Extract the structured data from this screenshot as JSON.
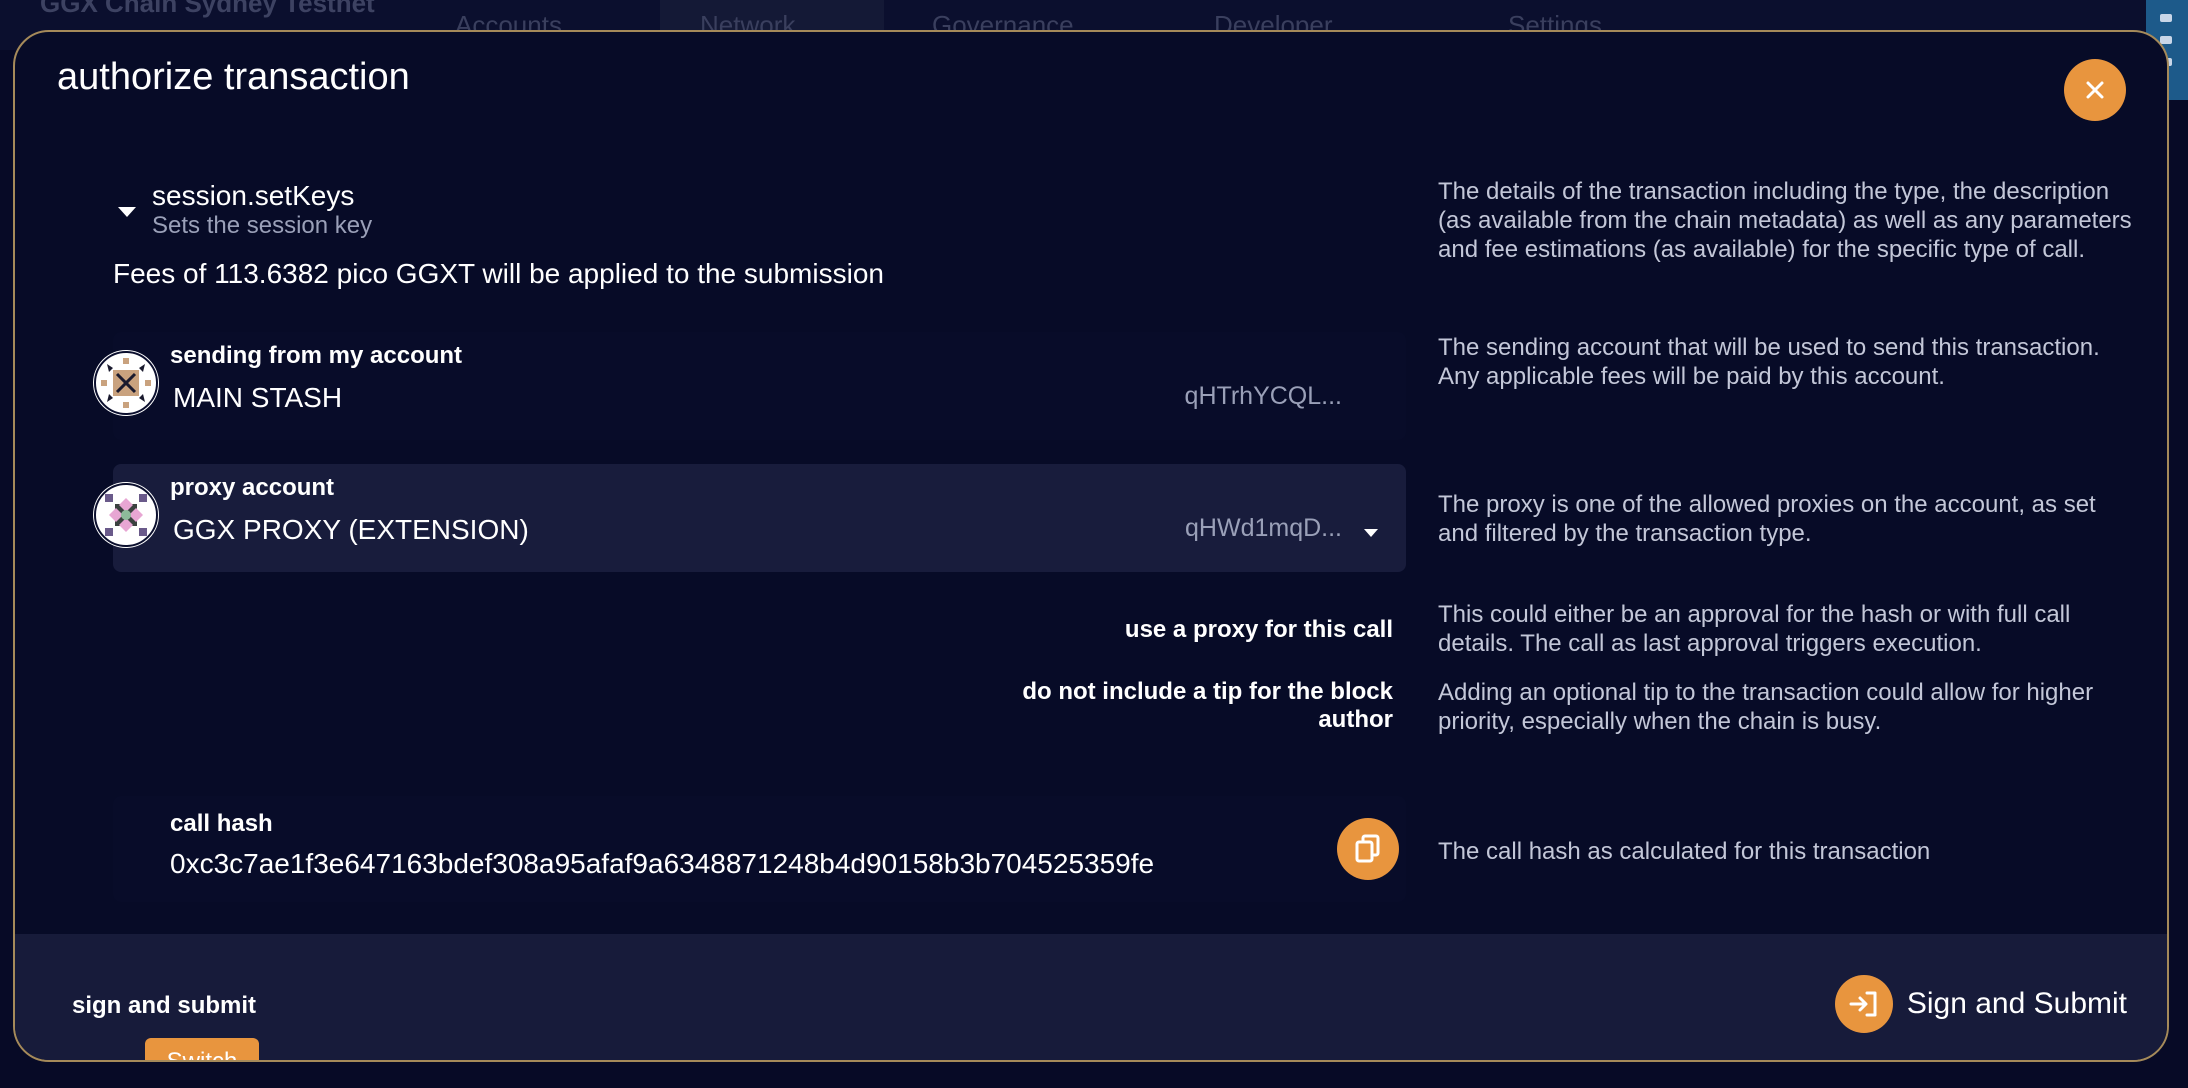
{
  "background": {
    "chain_name": "GGX Chain Sydney Testnet",
    "nav": [
      "Accounts",
      "Network",
      "Governance",
      "Developer",
      "Settings"
    ]
  },
  "modal": {
    "title": "authorize transaction"
  },
  "call": {
    "method": "session.setKeys",
    "description": "Sets the session key",
    "fees": "Fees of 113.6382 pico GGXT will be applied to the submission",
    "help": "The details of the transaction including the type, the description (as available from the chain metadata) as well as any parameters and fee estimations (as available) for the specific type of call."
  },
  "sender": {
    "label": "sending from my account",
    "name": "MAIN STASH",
    "address": "qHTrhYCQL...",
    "help": "The sending account that will be used to send this transaction. Any applicable fees will be paid by this account."
  },
  "proxy": {
    "label": "proxy account",
    "name": "GGX PROXY (EXTENSION)",
    "address": "qHWd1mqD...",
    "help": "The proxy is one of the allowed proxies on the account, as set and filtered by the transaction type."
  },
  "options": {
    "use_proxy_label": "use a proxy for this call",
    "use_proxy_help": "This could either be an approval for the hash or with full call details. The call as last approval triggers execution.",
    "tip_label_line1": "do not include a tip for the block",
    "tip_label_line2": "author",
    "tip_help": "Adding an optional tip to the transaction could allow for higher priority, especially when the chain is busy."
  },
  "call_hash": {
    "label": "call hash",
    "value": "0xc3c7ae1f3e647163bdef308a95afaf9a6348871248b4d90158b3b704525359fe",
    "help": "The call hash as calculated for this transaction"
  },
  "footer": {
    "mode_label": "sign and submit",
    "switch_label": "Switch",
    "submit_label": "Sign and Submit"
  },
  "colors": {
    "accent": "#e8953e",
    "background": "#070b27",
    "panel": "#181c3c"
  }
}
